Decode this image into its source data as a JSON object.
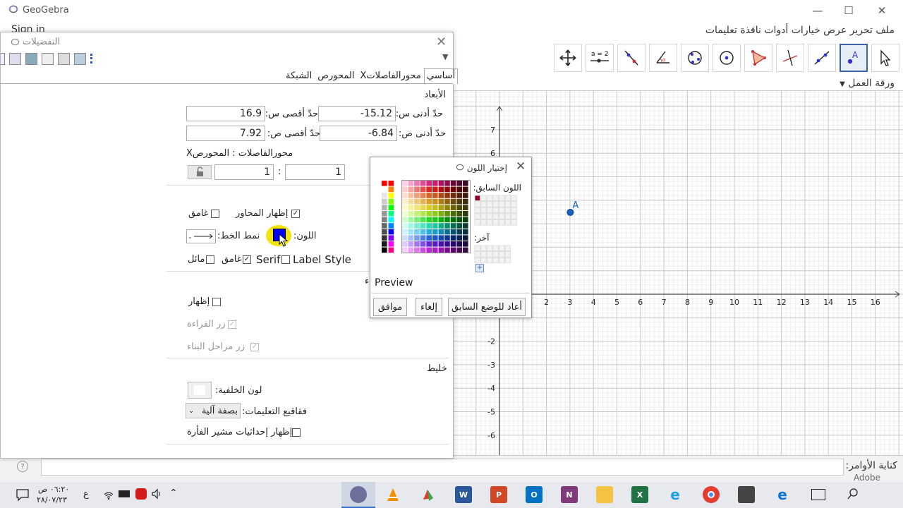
{
  "window": {
    "title": "GeoGebra",
    "minimize": "—",
    "maximize": "☐",
    "close": "✕"
  },
  "signin": "Sign in",
  "menubar": "ملف تحرير عرض خيارات أدوات نافذة تعليمات",
  "toolbar_tools": [
    "move-tool",
    "point-tool",
    "line-tool",
    "perpendicular-tool",
    "polygon-tool",
    "circle-tool",
    "circle-center-tool",
    "conic-tool",
    "reflect-tool",
    "angle-tool",
    "slider-tool",
    "text-tool",
    "move-graphics-tool"
  ],
  "graphics": {
    "title": "ورقة العمل",
    "point_label": "A",
    "x_ticks": [
      "2",
      "3",
      "4",
      "5",
      "6",
      "7",
      "8",
      "9",
      "10",
      "11",
      "12",
      "13",
      "14",
      "15",
      "16"
    ],
    "y_ticks_pos": [
      "7",
      "6"
    ],
    "y_ticks_neg": [
      "2",
      "3",
      "4",
      "5",
      "6"
    ]
  },
  "settings": {
    "title": "التفضيلات",
    "close": "✕",
    "tabs": [
      "أساسي",
      "محورالفاصلاتX",
      "المحورص",
      "الشبكة"
    ],
    "section_dimensions": "الأبعاد",
    "xmin_label": "حدّ أدنى س:",
    "xmin_value": "-15.12",
    "xmax_label": "حدّ أقصى س:",
    "xmax_value": "16.9",
    "ymin_label": "حدّ أدنى ص:",
    "ymin_value": "-6.84",
    "ymax_label": "حدّ أقصى ص:",
    "ymax_value": "7.92",
    "ratio_label": "محورالفاصلات : المحورصX",
    "ratio_x": "1",
    "ratio_sep": ":",
    "ratio_y": "1",
    "show_axes": "إظهار المحاور",
    "bold": "غامق",
    "color_label": "اللون:",
    "line_style": "نمط الخط:",
    "label_style": "Label Style",
    "serif": "Serif",
    "bold2": "غامق",
    "italic": "مائل",
    "section_nav": "ء",
    "show_nav": "إظهار",
    "play_button": "زر القراءة",
    "construction_steps": "زر مراحل البناء",
    "section_misc": "خليط",
    "background_color": "لون الخلفية:",
    "tooltips_label": "فقاقيع التعليمات:",
    "tooltips_value": "بصفة آلية",
    "show_mouse_coords": "إظهار إحداثيات مشير الفأرة",
    "colors": {
      "axis_color": "#0000ff",
      "highlight": "#f1e40f"
    }
  },
  "color_dialog": {
    "title": "إختيار اللون",
    "close": "✕",
    "previous_color": "اللون السابق:",
    "other": "آخر:",
    "preview": "Preview",
    "reset": "أعاد للوضع السابق",
    "cancel": "إلغاء",
    "ok": "موافق",
    "gray_column": [
      "#ff0000",
      "#ffffff",
      "#e6e6e6",
      "#cccccc",
      "#b3b3b3",
      "#999999",
      "#808080",
      "#666666",
      "#4d4d4d",
      "#333333",
      "#1a1a1a",
      "#000000"
    ],
    "side_column": [
      "#ff0000",
      "#ff8000",
      "#ffff00",
      "#80ff00",
      "#00ff00",
      "#00ff80",
      "#00ffff",
      "#0080ff",
      "#0000ff",
      "#8000ff",
      "#ff00ff",
      "#ff0080"
    ],
    "previous_swatch": "#8b0020"
  },
  "input_bar": {
    "label": "كتابة الأوامر:",
    "help": "?"
  },
  "adobe": "Adobe",
  "taskbar": {
    "time": "٠٦:٢٠ ص",
    "date": "٢٨/٠٧/٢٣",
    "lang": "ع",
    "apps": [
      "geogebra",
      "vlc",
      "paint",
      "word",
      "powerpoint",
      "outlook",
      "onenote",
      "explorer",
      "excel",
      "ie",
      "chrome",
      "store",
      "edge",
      "taskview",
      "search"
    ]
  }
}
